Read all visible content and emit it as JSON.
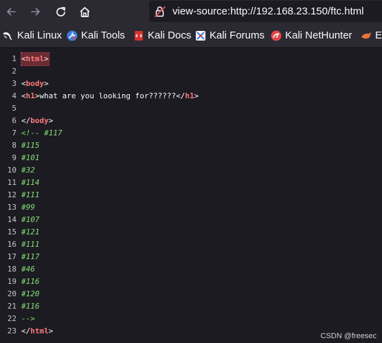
{
  "toolbar": {
    "back_icon": "arrow-left-icon",
    "forward_icon": "arrow-right-icon",
    "reload_icon": "reload-icon",
    "home_icon": "home-icon",
    "url": "view-source:http://192.168.23.150/ftc.html",
    "site_icon": "insecure-lock-icon"
  },
  "bookmarks": [
    {
      "label": "Kali Linux",
      "icon": "kali-dragon-icon"
    },
    {
      "label": "Kali Tools",
      "icon": "kali-tools-icon"
    },
    {
      "label": "Kali Docs",
      "icon": "kali-docs-icon"
    },
    {
      "label": "Kali Forums",
      "icon": "kali-forums-icon"
    },
    {
      "label": "Kali NetHunter",
      "icon": "nethunter-icon"
    },
    {
      "label": "Ex",
      "icon": "exploit-db-icon"
    }
  ],
  "source": {
    "lines": [
      {
        "n": "1",
        "parts": [
          [
            "p",
            "<"
          ],
          [
            "t",
            "html"
          ],
          [
            "p",
            ">"
          ]
        ],
        "highlight": true
      },
      {
        "n": "2",
        "parts": []
      },
      {
        "n": "3",
        "parts": [
          [
            "p",
            "<"
          ],
          [
            "t",
            "body"
          ],
          [
            "p",
            ">"
          ]
        ]
      },
      {
        "n": "4",
        "parts": [
          [
            "p",
            "<"
          ],
          [
            "t",
            "h1"
          ],
          [
            "p",
            ">what are you looking for??????</"
          ],
          [
            "t",
            "h1"
          ],
          [
            "p",
            ">"
          ]
        ]
      },
      {
        "n": "5",
        "parts": []
      },
      {
        "n": "6",
        "parts": [
          [
            "p",
            "</"
          ],
          [
            "t",
            "body"
          ],
          [
            "p",
            ">"
          ]
        ]
      },
      {
        "n": "7",
        "parts": [
          [
            "c",
            "<!-- #117"
          ]
        ]
      },
      {
        "n": "8",
        "parts": [
          [
            "c",
            "#115"
          ]
        ]
      },
      {
        "n": "9",
        "parts": [
          [
            "c",
            "#101"
          ]
        ]
      },
      {
        "n": "10",
        "parts": [
          [
            "c",
            "#32"
          ]
        ]
      },
      {
        "n": "11",
        "parts": [
          [
            "c",
            "#114"
          ]
        ]
      },
      {
        "n": "12",
        "parts": [
          [
            "c",
            "#111"
          ]
        ]
      },
      {
        "n": "13",
        "parts": [
          [
            "c",
            "#99"
          ]
        ]
      },
      {
        "n": "14",
        "parts": [
          [
            "c",
            "#107"
          ]
        ]
      },
      {
        "n": "15",
        "parts": [
          [
            "c",
            "#121"
          ]
        ]
      },
      {
        "n": "16",
        "parts": [
          [
            "c",
            "#111"
          ]
        ]
      },
      {
        "n": "17",
        "parts": [
          [
            "c",
            "#117"
          ]
        ]
      },
      {
        "n": "18",
        "parts": [
          [
            "c",
            "#46"
          ]
        ]
      },
      {
        "n": "19",
        "parts": [
          [
            "c",
            "#116"
          ]
        ]
      },
      {
        "n": "20",
        "parts": [
          [
            "c",
            "#120"
          ]
        ]
      },
      {
        "n": "21",
        "parts": [
          [
            "c",
            "#116"
          ]
        ]
      },
      {
        "n": "22",
        "parts": [
          [
            "c",
            "-->"
          ]
        ]
      },
      {
        "n": "23",
        "parts": [
          [
            "p",
            "</"
          ],
          [
            "t",
            "html"
          ],
          [
            "p",
            ">"
          ]
        ]
      }
    ]
  },
  "watermark": "CSDN @freesec"
}
